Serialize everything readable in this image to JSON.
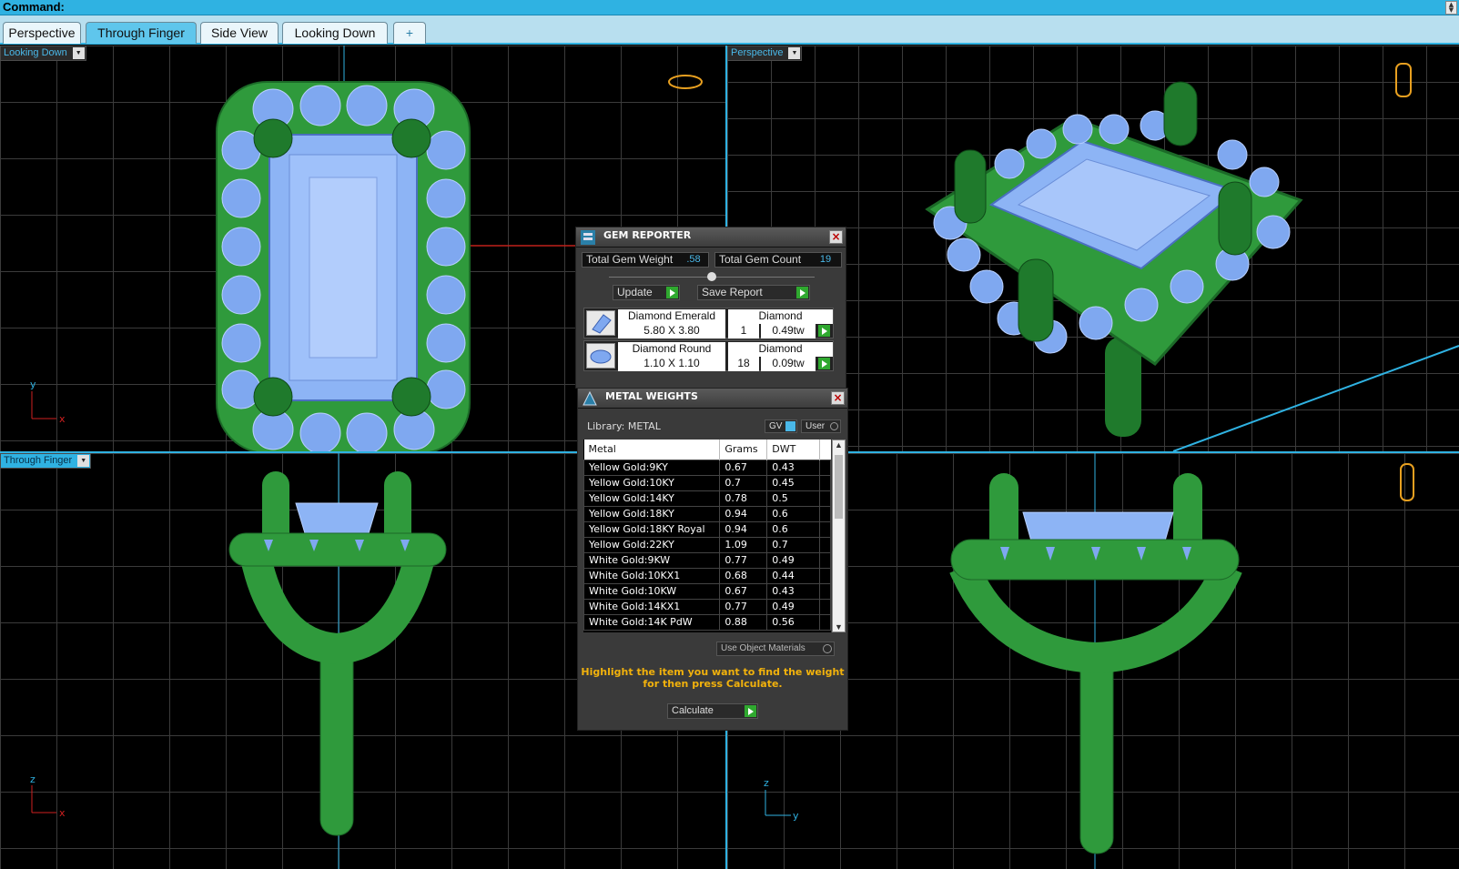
{
  "command": {
    "label": "Command:"
  },
  "tabs": [
    {
      "label": "Perspective",
      "active": false
    },
    {
      "label": "Through Finger",
      "active": true
    },
    {
      "label": "Side View",
      "active": false
    },
    {
      "label": "Looking Down",
      "active": false
    },
    {
      "label": "+",
      "active": false
    }
  ],
  "viewports": {
    "top_left": {
      "label": "Looking Down",
      "active": false,
      "axis": [
        "y",
        "x"
      ]
    },
    "top_right": {
      "label": "Perspective",
      "active": false
    },
    "bottom_left": {
      "label": "Through Finger",
      "active": true,
      "axis": [
        "z",
        "x"
      ]
    },
    "bottom_right": {
      "label": "",
      "active": false,
      "axis": [
        "z",
        "y"
      ]
    }
  },
  "gem_reporter": {
    "title": "GEM REPORTER",
    "total_weight_label": "Total Gem Weight",
    "total_weight": ".58",
    "total_count_label": "Total Gem Count",
    "total_count": "19",
    "update_label": "Update",
    "save_label": "Save Report",
    "gems": [
      {
        "name": "Diamond Emerald",
        "material": "Diamond",
        "size": "5.80 X 3.80",
        "qty": "1",
        "weight": "0.49tw"
      },
      {
        "name": "Diamond Round",
        "material": "Diamond",
        "size": "1.10 X 1.10",
        "qty": "18",
        "weight": "0.09tw"
      }
    ]
  },
  "metal_weights": {
    "title": "METAL WEIGHTS",
    "library_label": "Library: METAL",
    "gv_label": "GV",
    "user_label": "User",
    "columns": [
      "Metal",
      "Grams",
      "DWT"
    ],
    "rows": [
      [
        "Yellow Gold:9KY",
        "0.67",
        "0.43"
      ],
      [
        "Yellow Gold:10KY",
        "0.7",
        "0.45"
      ],
      [
        "Yellow Gold:14KY",
        "0.78",
        "0.5"
      ],
      [
        "Yellow Gold:18KY",
        "0.94",
        "0.6"
      ],
      [
        "Yellow Gold:18KY Royal",
        "0.94",
        "0.6"
      ],
      [
        "Yellow Gold:22KY",
        "1.09",
        "0.7"
      ],
      [
        "White Gold:9KW",
        "0.77",
        "0.49"
      ],
      [
        "White Gold:10KX1",
        "0.68",
        "0.44"
      ],
      [
        "White Gold:10KW",
        "0.67",
        "0.43"
      ],
      [
        "White Gold:14KX1",
        "0.77",
        "0.49"
      ],
      [
        "White Gold:14K PdW",
        "0.88",
        "0.56"
      ]
    ],
    "use_object_materials": "Use Object Materials",
    "hint": "Highlight the item you want to find the weight for then press Calculate.",
    "calculate_label": "Calculate"
  },
  "colors": {
    "metal_green": "#2f9a3c",
    "gem_blue": "#7fa8f0",
    "accent": "#2fb2e2"
  }
}
